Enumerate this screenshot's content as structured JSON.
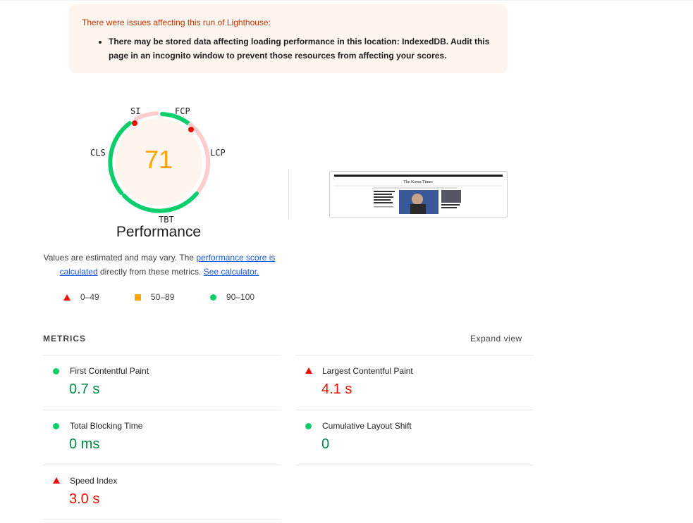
{
  "warning": {
    "title": "There were issues affecting this run of Lighthouse:",
    "item": "There may be stored data affecting loading performance in this location: IndexedDB. Audit this page in an incognito window to prevent those resources from affecting your scores."
  },
  "gauge": {
    "score": "71",
    "label": "Performance",
    "metric_tags": {
      "si": "SI",
      "fcp": "FCP",
      "lcp": "LCP",
      "tbt": "TBT",
      "cls": "CLS"
    },
    "score_color": "#ffa400"
  },
  "explain": {
    "text1": "Values are estimated and may vary. The ",
    "link1": "performance score is calculated",
    "text2": " directly from these metrics. ",
    "link2": "See calculator."
  },
  "legend": {
    "fail": "0–49",
    "average": "50–89",
    "pass": "90–100"
  },
  "metrics": {
    "header": "METRICS",
    "expand": "Expand view",
    "items": [
      {
        "title": "First Contentful Paint",
        "value": "0.7 s",
        "status": "pass"
      },
      {
        "title": "Largest Contentful Paint",
        "value": "4.1 s",
        "status": "fail"
      },
      {
        "title": "Total Blocking Time",
        "value": "0 ms",
        "status": "pass"
      },
      {
        "title": "Cumulative Layout Shift",
        "value": "0",
        "status": "pass"
      },
      {
        "title": "Speed Index",
        "value": "3.0 s",
        "status": "fail"
      }
    ]
  },
  "thumbnail": {
    "site_name": "The Korea Times"
  },
  "colors": {
    "pass": "#0cce6b",
    "average": "#ffa400",
    "fail": "#eb0f00",
    "pass_text": "#018642"
  }
}
